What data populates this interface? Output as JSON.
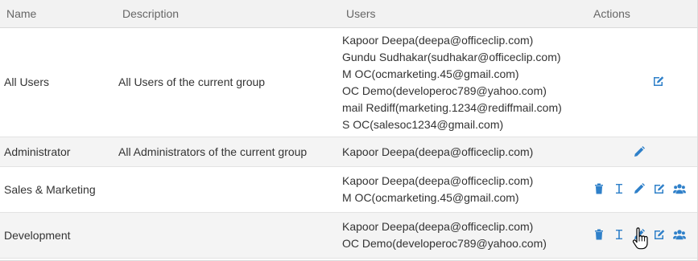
{
  "columns": {
    "name": "Name",
    "description": "Description",
    "users": "Users",
    "actions": "Actions"
  },
  "rows": [
    {
      "name": "All Users",
      "description": "All Users of the current group",
      "users": [
        "Kapoor Deepa(deepa@officeclip.com)",
        "Gundu Sudhakar(sudhakar@officeclip.com)",
        "M OC(ocmarketing.45@gmail.com)",
        "OC Demo(developeroc789@yahoo.com)",
        "mail Rediff(marketing.1234@rediffmail.com)",
        "S OC(salesoc1234@gmail.com)"
      ],
      "actions": [
        "edit-users-icon"
      ]
    },
    {
      "name": "Administrator",
      "description": "All Administrators of the current group",
      "users": [
        "Kapoor Deepa(deepa@officeclip.com)"
      ],
      "actions": [
        "pencil-icon"
      ]
    },
    {
      "name": "Sales & Marketing",
      "description": "",
      "users": [
        "Kapoor Deepa(deepa@officeclip.com)",
        "M OC(ocmarketing.45@gmail.com)"
      ],
      "actions": [
        "trash-icon",
        "text-cursor-icon",
        "pencil-icon",
        "edit-users-icon",
        "group-icon"
      ]
    },
    {
      "name": "Development",
      "description": "",
      "users": [
        "Kapoor Deepa(deepa@officeclip.com)",
        "OC Demo(developeroc789@yahoo.com)"
      ],
      "actions": [
        "trash-icon",
        "text-cursor-icon",
        "pencil-icon",
        "edit-users-icon",
        "group-icon"
      ]
    }
  ],
  "colors": {
    "icon": "#2f80c9",
    "header_bg": "#f2f2f2",
    "alt_row_bg": "#f4f4f4"
  }
}
